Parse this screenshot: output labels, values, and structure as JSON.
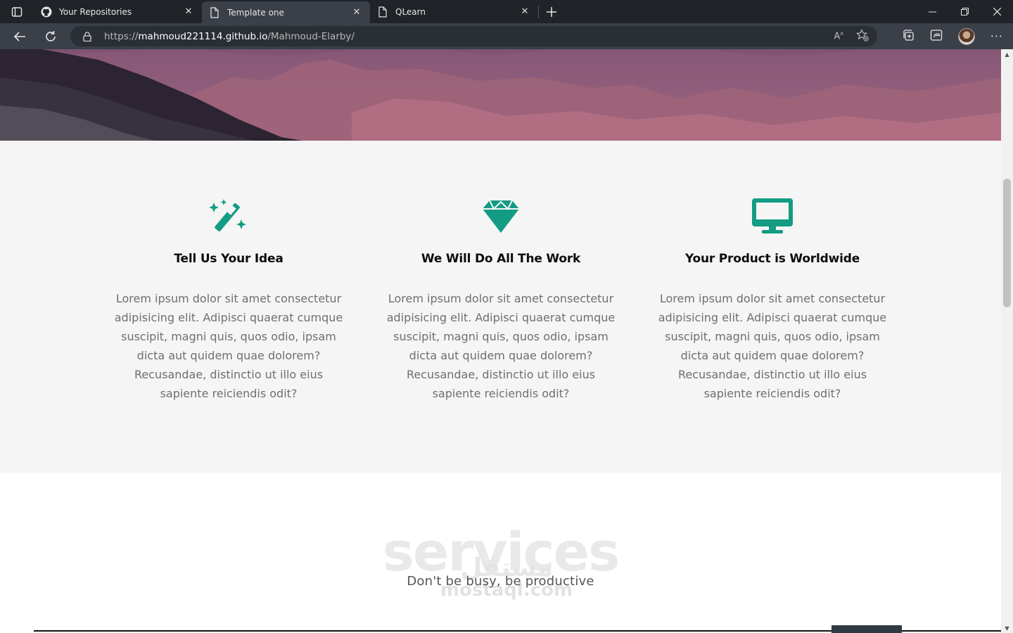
{
  "browser": {
    "tabs": [
      {
        "label": "Your Repositories",
        "icon": "github-icon"
      },
      {
        "label": "Template one",
        "icon": "page-icon"
      },
      {
        "label": "QLearn",
        "icon": "page-icon"
      }
    ],
    "url_scheme": "https://",
    "url_host": "mahmoud221114.github.io",
    "url_path": "/Mahmoud-Elarby/"
  },
  "features": [
    {
      "icon": "magic-wand-icon",
      "title": "Tell Us Your Idea",
      "text": "Lorem ipsum dolor sit amet consectetur adipisicing elit. Adipisci quaerat cumque suscipit, magni quis, quos odio, ipsam dicta aut quidem quae dolorem? Recusandae, distinctio ut illo eius sapiente reiciendis odit?"
    },
    {
      "icon": "gem-icon",
      "title": "We Will Do All The Work",
      "text": "Lorem ipsum dolor sit amet consectetur adipisicing elit. Adipisci quaerat cumque suscipit, magni quis, quos odio, ipsam dicta aut quidem quae dolorem? Recusandae, distinctio ut illo eius sapiente reiciendis odit?"
    },
    {
      "icon": "desktop-icon",
      "title": "Your Product is Worldwide",
      "text": "Lorem ipsum dolor sit amet consectetur adipisicing elit. Adipisci quaerat cumque suscipit, magni quis, quos odio, ipsam dicta aut quidem quae dolorem? Recusandae, distinctio ut illo eius sapiente reiciendis odit?"
    }
  ],
  "services": {
    "title": "services",
    "subtitle": "Don't be busy, be productive"
  },
  "watermark": {
    "arabic": "مستقل",
    "latin": "mostaql.com"
  },
  "colors": {
    "accent": "#139c83",
    "chrome_dark": "#202328",
    "chrome_mid": "#3a3f48",
    "feature_bg": "#f5f5f5"
  }
}
